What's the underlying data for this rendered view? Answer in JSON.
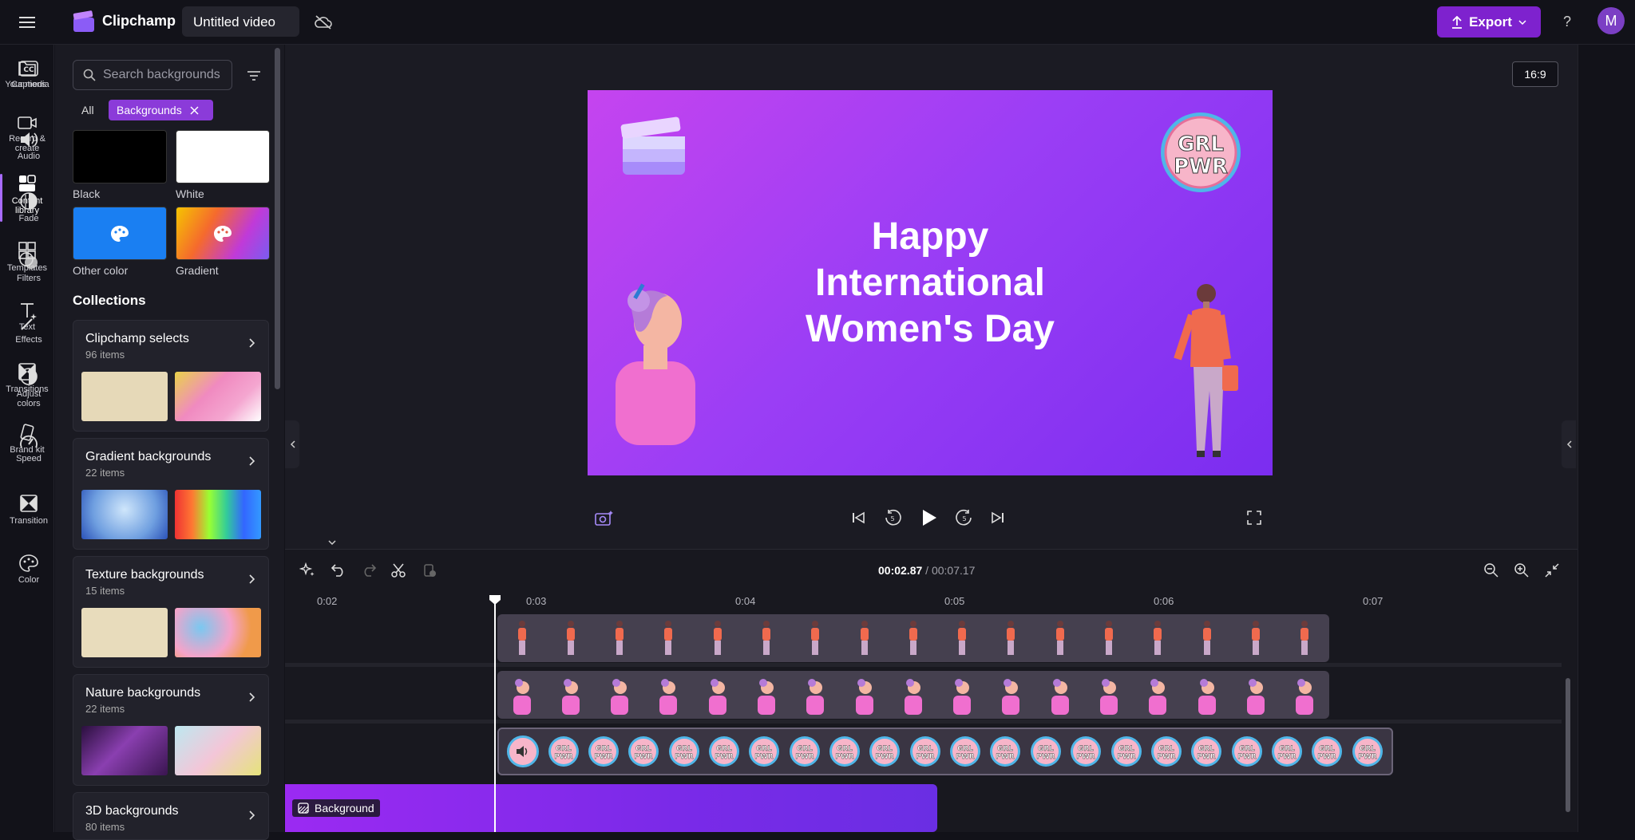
{
  "app": {
    "name": "Clipchamp",
    "video_title": "Untitled video",
    "export_label": "Export",
    "avatar_initial": "M"
  },
  "left_rail": [
    {
      "label": "Your media",
      "icon": "folder-icon"
    },
    {
      "label": "Record &\ncreate",
      "icon": "camera-icon"
    },
    {
      "label": "Content\nlibrary",
      "icon": "content-library-icon",
      "active": true
    },
    {
      "label": "Templates",
      "icon": "templates-icon"
    },
    {
      "label": "Text",
      "icon": "text-icon"
    },
    {
      "label": "Transitions",
      "icon": "transitions-icon"
    },
    {
      "label": "Brand kit",
      "icon": "brand-kit-icon"
    }
  ],
  "right_rail": [
    {
      "label": "Captions",
      "icon": "captions-icon"
    },
    {
      "label": "Audio",
      "icon": "speaker-icon"
    },
    {
      "label": "Fade",
      "icon": "fade-icon"
    },
    {
      "label": "Filters",
      "icon": "filters-icon"
    },
    {
      "label": "Effects",
      "icon": "wand-icon"
    },
    {
      "label": "Adjust\ncolors",
      "icon": "adjust-colors-icon"
    },
    {
      "label": "Speed",
      "icon": "speed-icon"
    },
    {
      "label": "Transition",
      "icon": "transition-icon"
    },
    {
      "label": "Color",
      "icon": "palette-icon"
    }
  ],
  "panel": {
    "search_placeholder": "Search backgrounds",
    "chip_all": "All",
    "chip_active": "Backgrounds",
    "swatches": [
      {
        "label": "Black",
        "color": "#000000"
      },
      {
        "label": "White",
        "color": "#ffffff"
      },
      {
        "label": "Other color",
        "color": "#1a7ff2"
      },
      {
        "label": "Gradient",
        "color": "gradient"
      }
    ],
    "collections_heading": "Collections",
    "collections": [
      {
        "title": "Clipchamp selects",
        "count": "96 items"
      },
      {
        "title": "Gradient backgrounds",
        "count": "22 items"
      },
      {
        "title": "Texture backgrounds",
        "count": "15 items"
      },
      {
        "title": "Nature backgrounds",
        "count": "22 items"
      },
      {
        "title": "3D backgrounds",
        "count": "80 items"
      }
    ]
  },
  "preview": {
    "aspect_ratio": "16:9",
    "text_lines": [
      "Happy",
      "International",
      "Women's Day"
    ],
    "sticker_text": "GRL PWR"
  },
  "timeline": {
    "current_time": "00:02.87",
    "total_time": "/ 00:07.17",
    "ticks": [
      "0:02",
      "0:03",
      "0:04",
      "0:05",
      "0:06",
      "0:07"
    ],
    "background_clip_label": "Background"
  }
}
